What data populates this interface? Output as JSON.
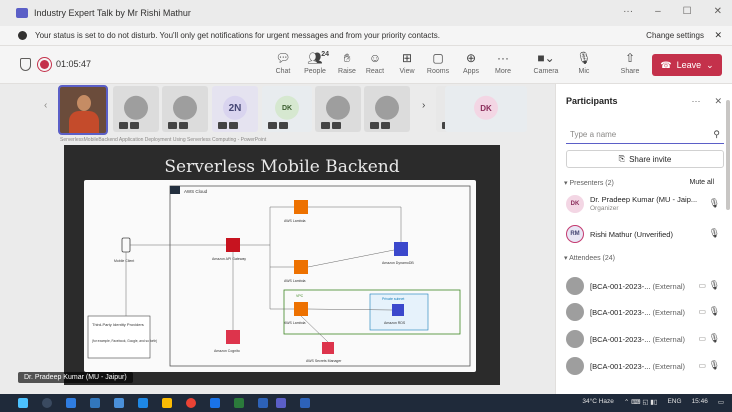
{
  "window": {
    "title": "Industry Expert Talk by Mr Rishi Mathur",
    "controls": [
      "···",
      "–",
      "☐",
      "✕"
    ]
  },
  "banner": {
    "message": "Your status is set to do not disturb. You'll only get notifications for urgent messages and from your priority contacts.",
    "link": "Change settings"
  },
  "toolbar": {
    "timer": "01:05:47",
    "buttons": [
      {
        "label": "Chat",
        "icon": "chat-icon"
      },
      {
        "label": "People",
        "icon": "people-icon",
        "count": "24"
      },
      {
        "label": "Raise",
        "icon": "raise-hand-icon"
      },
      {
        "label": "React",
        "icon": "react-icon"
      },
      {
        "label": "View",
        "icon": "view-icon"
      },
      {
        "label": "Rooms",
        "icon": "rooms-icon"
      },
      {
        "label": "Apps",
        "icon": "apps-icon"
      },
      {
        "label": "More",
        "icon": "more-icon"
      },
      {
        "label": "Camera",
        "icon": "camera-icon"
      },
      {
        "label": "Mic",
        "icon": "mic-icon"
      },
      {
        "label": "Share",
        "icon": "share-icon"
      }
    ],
    "leave_label": "Leave"
  },
  "gallery": {
    "tiles": [
      {
        "initials": ""
      },
      {
        "initials": ""
      },
      {
        "initials": "2N"
      },
      {
        "initials": "DK"
      },
      {
        "initials": ""
      },
      {
        "initials": ""
      }
    ],
    "overflow_initials": "DK"
  },
  "screen": {
    "strip_text": "ServerlessMobileBackend   Application Deployment Using Serverless Computing - PowerPoint",
    "slide_title": "Serverless Mobile Backend",
    "diagram_labels": {
      "cloud": "AWS Cloud",
      "api": "Amazon API Gateway",
      "lambda1": "AWS Lambda",
      "lambda2": "AWS Lambda",
      "lambda3": "AWS Lambda",
      "dynamo": "Amazon DynamoDB",
      "cognito": "Amazon Cognito",
      "rds": "Amazon RDS",
      "secrets": "AWS Secrets Manager",
      "client": "Mobile Client",
      "idp": "Third-Party Identity Providers",
      "idp_examples": "(for example, Facebook, Google, and so forth)",
      "vpc": "VPC",
      "subnet": "Private subnet"
    },
    "presenter_label": "Dr. Pradeep Kumar (MU - Jaipur)"
  },
  "panel": {
    "title": "Participants",
    "search_placeholder": "Type a name",
    "share_invite": "Share invite",
    "presenters_header": "Presenters (2)",
    "mute_all": "Mute all",
    "presenters": [
      {
        "initials": "DK",
        "name": "Dr. Pradeep Kumar (MU - Jaip...",
        "role": "Organizer"
      },
      {
        "initials": "RM",
        "name": "Rishi Mathur (Unverified)",
        "role": ""
      }
    ],
    "attendees_header": "Attendees (24)",
    "attendees": [
      {
        "name": "[BCA-001-2023-...",
        "tag": "(External)"
      },
      {
        "name": "[BCA-001-2023-...",
        "tag": "(External)"
      },
      {
        "name": "[BCA-001-2023-...",
        "tag": "(External)"
      },
      {
        "name": "[BCA-001-2023-...",
        "tag": "(External)"
      }
    ]
  },
  "taskbar": {
    "weather": "34°C Haze",
    "lang": "ENG",
    "time": "15:46"
  }
}
